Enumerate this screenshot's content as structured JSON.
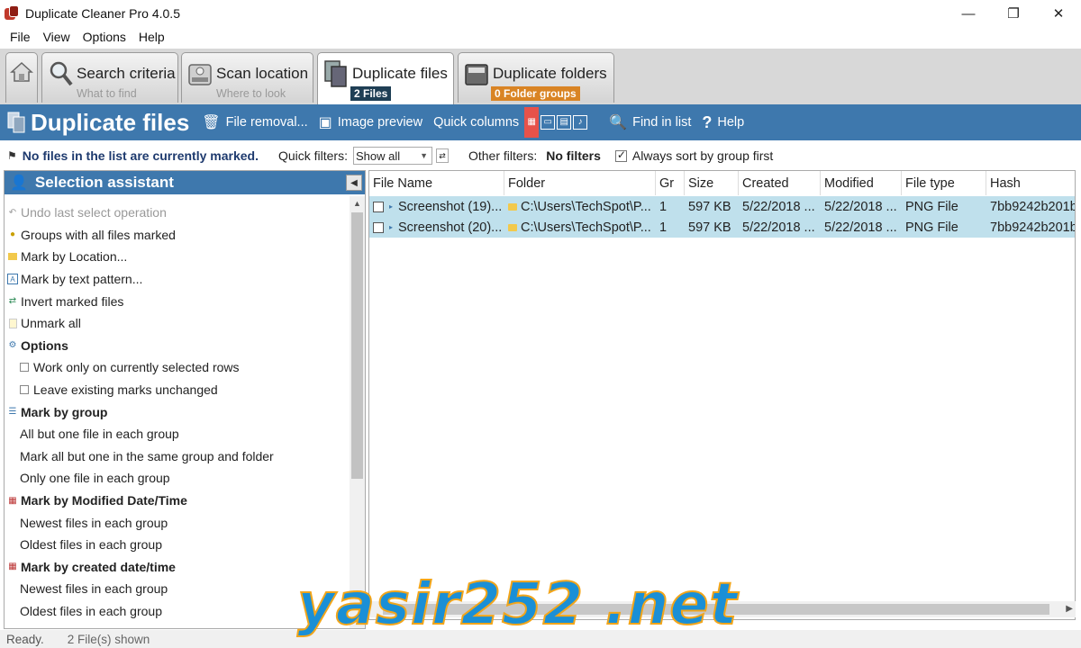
{
  "window": {
    "title": "Duplicate Cleaner Pro 4.0.5",
    "controls": {
      "minimize": "—",
      "restore": "❐",
      "close": "✕"
    }
  },
  "menu": [
    "File",
    "View",
    "Options",
    "Help"
  ],
  "tabs": [
    {
      "title": "",
      "subtitle": "",
      "icon": "home-icon"
    },
    {
      "title": "Search criteria",
      "subtitle": "What to find",
      "icon": "magnifier-icon"
    },
    {
      "title": "Scan location",
      "subtitle": "Where to look",
      "icon": "drive-icon"
    },
    {
      "title": "Duplicate files",
      "badge": "2 Files",
      "badge_color": "#1f3f55",
      "icon": "files-icon",
      "active": true
    },
    {
      "title": "Duplicate folders",
      "badge": "0 Folder groups",
      "badge_color": "#d98424",
      "icon": "folder-icon"
    }
  ],
  "header": {
    "title": "Duplicate files",
    "buttons": {
      "file_removal": "File removal...",
      "image_preview": "Image preview",
      "quick_columns": "Quick columns",
      "find_in_list": "Find in list",
      "help": "Help"
    },
    "background": "#3e78ad"
  },
  "filters": {
    "marked_note": "No files in the list are currently marked.",
    "quick_filters_label": "Quick filters:",
    "quick_filter_value": "Show all",
    "other_filters_label": "Other filters:",
    "other_filters_value": "No filters",
    "sort_label": "Always sort by group first",
    "sort_checked": true
  },
  "selection_assistant": {
    "title": "Selection assistant",
    "items": [
      {
        "label": "Undo last select operation",
        "disabled": true,
        "icon": "undo-icon"
      },
      {
        "label": "Groups with all files marked",
        "icon": "warning-icon"
      },
      {
        "label": "Mark by Location...",
        "icon": "folder-icon"
      },
      {
        "label": "Mark by text pattern...",
        "icon": "text-pattern-icon"
      },
      {
        "label": "Invert marked files",
        "icon": "invert-icon"
      },
      {
        "label": "Unmark all",
        "icon": "unmark-icon"
      },
      {
        "label": "Options",
        "bold": true,
        "icon": "options-icon"
      },
      {
        "label": "Work only on currently selected rows",
        "checkbox": true
      },
      {
        "label": "Leave existing marks unchanged",
        "checkbox": true
      },
      {
        "label": "Mark by group",
        "bold": true,
        "icon": "group-icon"
      },
      {
        "label": "All but one file in each group",
        "indent": true
      },
      {
        "label": "Mark all but one in the same group and folder",
        "indent": true
      },
      {
        "label": "Only one file in each group",
        "indent": true
      },
      {
        "label": "Mark by Modified Date/Time",
        "bold": true,
        "icon": "calendar-icon"
      },
      {
        "label": "Newest files in each group",
        "indent": true
      },
      {
        "label": "Oldest files in each group",
        "indent": true
      },
      {
        "label": "Mark by created date/time",
        "bold": true,
        "icon": "calendar-icon"
      },
      {
        "label": "Newest files in each group",
        "indent": true
      },
      {
        "label": "Oldest files in each group",
        "indent": true
      }
    ]
  },
  "table": {
    "columns": [
      "File Name",
      "Folder",
      "Gr",
      "Size",
      "Created",
      "Modified",
      "File type",
      "Hash"
    ],
    "rows": [
      [
        "Screenshot (19)...",
        "C:\\Users\\TechSpot\\P...",
        "1",
        "597 KB",
        "5/22/2018 ...",
        "5/22/2018 ...",
        "PNG File",
        "7bb9242b201b"
      ],
      [
        "Screenshot (20)...",
        "C:\\Users\\TechSpot\\P...",
        "1",
        "597 KB",
        "5/22/2018 ...",
        "5/22/2018 ...",
        "PNG File",
        "7bb9242b201b"
      ]
    ],
    "row_color": "#bfe0ec"
  },
  "status": {
    "state": "Ready.",
    "count": "2 File(s) shown"
  },
  "watermark": "yasir252 .net"
}
